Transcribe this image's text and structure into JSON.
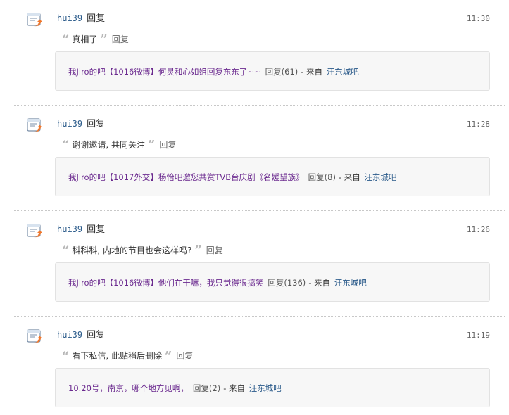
{
  "feed": {
    "items": [
      {
        "user": "hui39",
        "action": "回复",
        "time": "11:30",
        "quote": "真相了",
        "reply_label": "回复",
        "thread_title": "我Jiro的吧【1016微博】何炅和心如姐回复东东了~~",
        "reply_count": "回复(61)",
        "from_label": "- 来自",
        "forum": "汪东城吧"
      },
      {
        "user": "hui39",
        "action": "回复",
        "time": "11:28",
        "quote": "谢谢邀请, 共同关注",
        "reply_label": "回复",
        "thread_title": "我Jiro的吧【1017外交】杨怡吧邀您共赏TVB台庆剧《名媛望族》",
        "reply_count": "回复(8)",
        "from_label": "- 来自",
        "forum": "汪东城吧"
      },
      {
        "user": "hui39",
        "action": "回复",
        "time": "11:26",
        "quote": "科科科, 内地的节目也会这样吗?",
        "reply_label": "回复",
        "thread_title": "我Jiro的吧【1016微博】他们在干嘛，我只觉得很搞笑",
        "reply_count": "回复(136)",
        "from_label": "- 来自",
        "forum": "汪东城吧"
      },
      {
        "user": "hui39",
        "action": "回复",
        "time": "11:19",
        "quote": "看下私信, 此贴稍后删除",
        "reply_label": "回复",
        "thread_title": "10.20号，南京，哪个地方见啊，",
        "reply_count": "回复(2)",
        "from_label": "- 来自",
        "forum": "汪东城吧"
      }
    ]
  }
}
